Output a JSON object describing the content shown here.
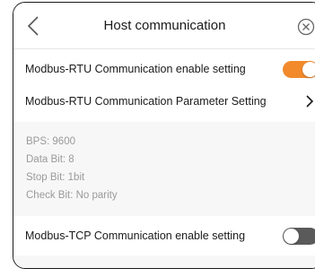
{
  "header": {
    "title": "Host communication",
    "back_icon": "chevron-left-icon",
    "close_icon": "close-circle-icon"
  },
  "rows": {
    "rtu_enable": {
      "label": "Modbus-RTU Communication enable setting",
      "enabled": true
    },
    "rtu_params": {
      "label": "Modbus-RTU Communication Parameter Setting",
      "icon": "chevron-right-icon"
    },
    "tcp_enable": {
      "label": "Modbus-TCP Communication enable setting",
      "enabled": false
    }
  },
  "params": {
    "bps": "BPS: 9600",
    "data_bit": "Data Bit: 8",
    "stop_bit": "Stop Bit: 1bit",
    "check_bit": "Check Bit: No parity"
  },
  "colors": {
    "toggle_on": "#f28a2c",
    "toggle_off": "#5a5a5a"
  }
}
